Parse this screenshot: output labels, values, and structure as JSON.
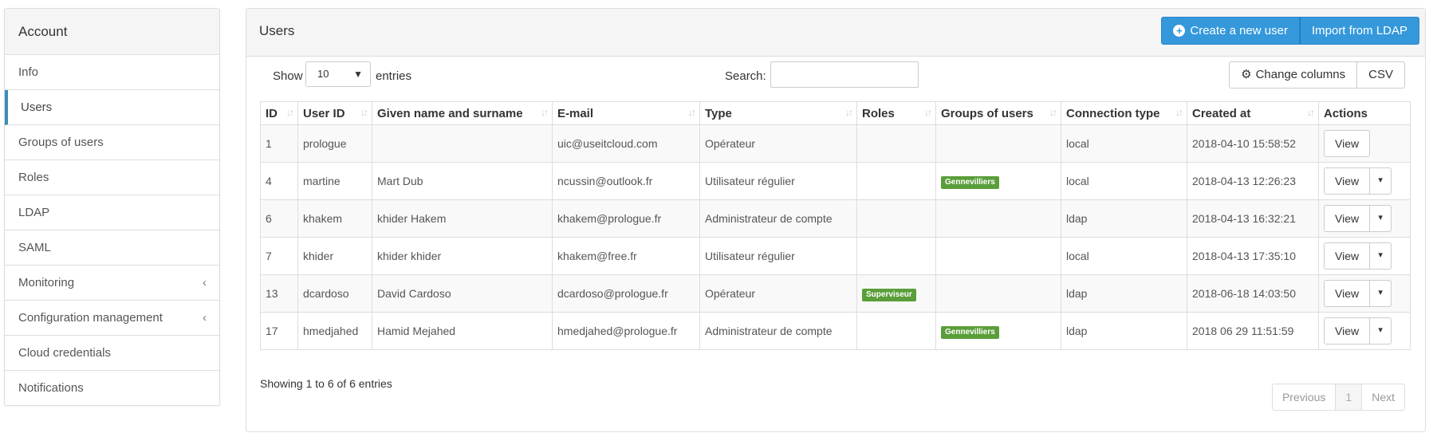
{
  "sidebar": {
    "title": "Account",
    "items": [
      {
        "label": "Info"
      },
      {
        "label": "Users"
      },
      {
        "label": "Groups of users"
      },
      {
        "label": "Roles"
      },
      {
        "label": "LDAP"
      },
      {
        "label": "SAML"
      },
      {
        "label": "Monitoring"
      },
      {
        "label": "Configuration management"
      },
      {
        "label": "Cloud credentials"
      },
      {
        "label": "Notifications"
      }
    ],
    "chevron": "‹"
  },
  "panel": {
    "title": "Users",
    "create_button": "Create a new user",
    "import_button": "Import from LDAP"
  },
  "controls": {
    "show_label": "Show",
    "entries_value": "10",
    "entries_label": "entries",
    "search_label": "Search:",
    "search_value": "",
    "change_columns": "Change columns",
    "csv": "CSV"
  },
  "table": {
    "headers": [
      "ID",
      "User ID",
      "Given name and surname",
      "E-mail",
      "Type",
      "Roles",
      "Groups of users",
      "Connection type",
      "Created at",
      "Actions"
    ],
    "rows": [
      {
        "id": "1",
        "user_id": "prologue",
        "name": "",
        "email": "uic@useitcloud.com",
        "type": "Opérateur",
        "role": "",
        "group": "",
        "connection": "local",
        "created": "2018-04-10 15:58:52",
        "action": "View",
        "split": false
      },
      {
        "id": "4",
        "user_id": "martine",
        "name": "Mart Dub",
        "email": "ncussin@outlook.fr",
        "type": "Utilisateur régulier",
        "role": "",
        "group": "Gennevilliers",
        "connection": "local",
        "created": "2018-04-13 12:26:23",
        "action": "View",
        "split": true
      },
      {
        "id": "6",
        "user_id": "khakem",
        "name": "khider Hakem",
        "email": "khakem@prologue.fr",
        "type": "Administrateur de compte",
        "role": "",
        "group": "",
        "connection": "ldap",
        "created": "2018-04-13 16:32:21",
        "action": "View",
        "split": true
      },
      {
        "id": "7",
        "user_id": "khider",
        "name": "khider khider",
        "email": "khakem@free.fr",
        "type": "Utilisateur régulier",
        "role": "",
        "group": "",
        "connection": "local",
        "created": "2018-04-13 17:35:10",
        "action": "View",
        "split": true
      },
      {
        "id": "13",
        "user_id": "dcardoso",
        "name": "David Cardoso",
        "email": "dcardoso@prologue.fr",
        "type": "Opérateur",
        "role": "Superviseur",
        "group": "",
        "connection": "ldap",
        "created": "2018-06-18 14:03:50",
        "action": "View",
        "split": true
      },
      {
        "id": "17",
        "user_id": "hmedjahed",
        "name": "Hamid Mejahed",
        "email": "hmedjahed@prologue.fr",
        "type": "Administrateur de compte",
        "role": "",
        "group": "Gennevilliers",
        "connection": "ldap",
        "created": "2018 06 29 11:51:59",
        "action": "View",
        "split": true
      }
    ]
  },
  "footer": {
    "info": "Showing 1 to 6 of 6 entries",
    "previous": "Previous",
    "page": "1",
    "next": "Next"
  },
  "colors": {
    "primary": "#3498db",
    "active_accent": "#3c8dbc",
    "badge": "#5a9e3a"
  }
}
